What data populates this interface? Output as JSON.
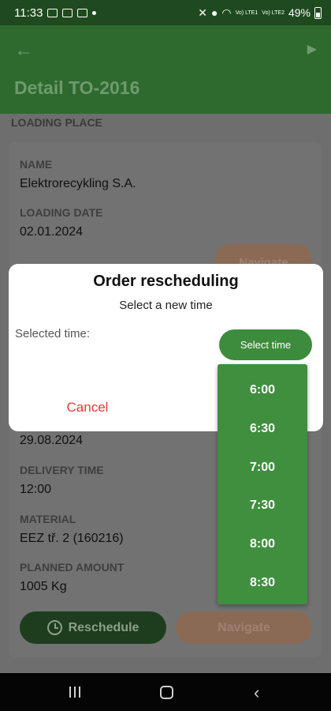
{
  "status_bar": {
    "time": "11:33",
    "battery": "49%",
    "net1": "Vo) LTE1",
    "net2": "Vo) LTE2"
  },
  "app_bar": {
    "back_icon": "arrow-left-icon",
    "play_icon": "play-icon",
    "title": "Detail TO-2016"
  },
  "section_label": "LOADING PLACE",
  "loading": {
    "name_label": "NAME",
    "name_value": "Elektrorecykling S.A.",
    "date_label": "LOADING DATE",
    "date_value": "02.01.2024",
    "navigate_label": "Navigate"
  },
  "delivery": {
    "date_value": "29.08.2024",
    "time_label": "DELIVERY TIME",
    "time_value": "12:00",
    "material_label": "MATERIAL",
    "material_value": "EEZ tř. 2 (160216)",
    "amount_label": "PLANNED AMOUNT",
    "amount_value": "1005 Kg"
  },
  "actions": {
    "reschedule_label": "Reschedule",
    "navigate_label": "Navigate"
  },
  "dialog": {
    "title": "Order rescheduling",
    "subtitle": "Select a new time",
    "selected_label": "Selected time:",
    "select_button": "Select time",
    "cancel": "Cancel"
  },
  "time_options": [
    "6:00",
    "6:30",
    "7:00",
    "7:30",
    "8:00",
    "8:30"
  ],
  "colors": {
    "primary_green": "#3d8c3d",
    "cancel_red": "#e53935",
    "navigate_tan": "#d9a78a"
  }
}
